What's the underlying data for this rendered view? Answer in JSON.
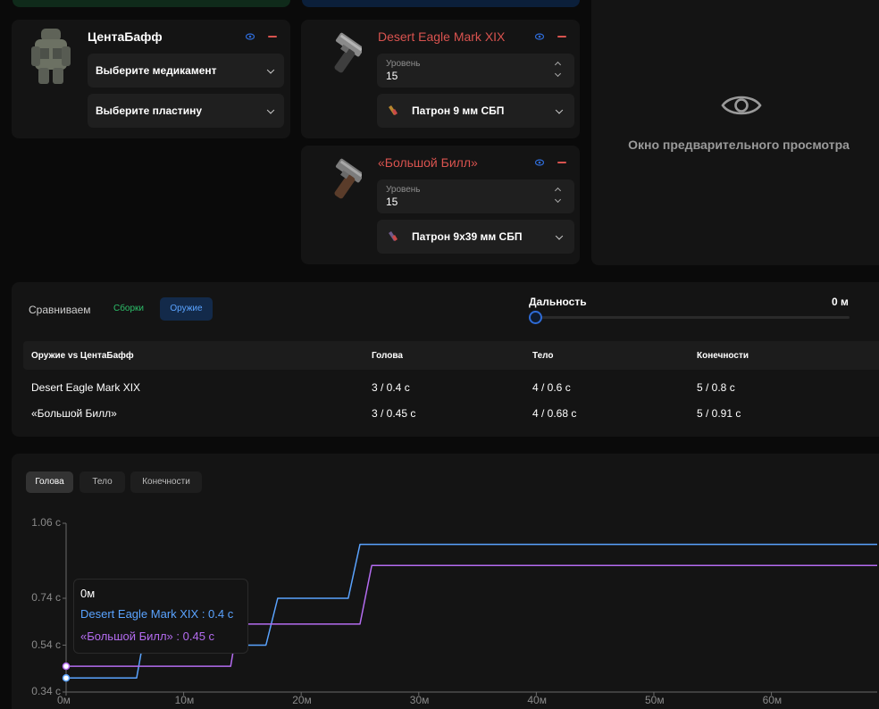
{
  "colors": {
    "background": "#0a0a0a",
    "panel": "#141414",
    "accent_red": "#d9534f",
    "accent_blue": "#2e6bd6",
    "series_blue": "#5aa3ff",
    "series_purple": "#b46cf0",
    "green": "#2dbf6a"
  },
  "armor_card": {
    "title": "ЦентаБафф",
    "medkit_select": "Выберите медикамент",
    "plate_select": "Выберите пластину",
    "icons": [
      "eye-icon",
      "minus-icon"
    ]
  },
  "weapons": [
    {
      "title": "Desert Eagle Mark XIX",
      "level_caption": "Уровень",
      "level_value": "15",
      "ammo": "Патрон 9 мм СБП"
    },
    {
      "title": "«Большой Билл»",
      "level_caption": "Уровень",
      "level_value": "15",
      "ammo": "Патрон 9x39 мм СБП"
    }
  ],
  "preview": {
    "text": "Окно предварительного просмотра",
    "icon": "eye-icon"
  },
  "compare": {
    "label": "Сравниваем",
    "mode_builds": "Сборки",
    "mode_weapons": "Оружие",
    "active_mode": "Оружие",
    "range_label": "Дальность",
    "range_value": "0 м",
    "range_fraction": 0
  },
  "table": {
    "headers": [
      "Оружие vs ЦентаБафф",
      "Голова",
      "Тело",
      "Конечности"
    ],
    "rows": [
      [
        "Desert Eagle Mark XIX",
        "3 / 0.4 с",
        "4 / 0.6 с",
        "5 / 0.8 с"
      ],
      [
        "«Большой Билл»",
        "3 / 0.45 с",
        "4 / 0.68 с",
        "5 / 0.91 с"
      ]
    ]
  },
  "chart_tabs": [
    "Голова",
    "Тело",
    "Конечности"
  ],
  "active_chart_tab": "Голова",
  "chart_data": {
    "type": "line",
    "title": "",
    "xlabel": "",
    "ylabel": "",
    "xlim": [
      0,
      69
    ],
    "ylim": [
      0.34,
      1.06
    ],
    "x_ticks": [
      "0м",
      "10м",
      "20м",
      "30м",
      "40м",
      "50м",
      "60м"
    ],
    "y_ticks": [
      "1.06 с",
      "0.74 с",
      "0.54 с",
      "0.34 с"
    ],
    "series": [
      {
        "name": "Desert Eagle Mark XIX",
        "color": "#5aa3ff",
        "points": [
          [
            0,
            0.4
          ],
          [
            6,
            0.4
          ],
          [
            6.5,
            0.54
          ],
          [
            17,
            0.54
          ],
          [
            18,
            0.74
          ],
          [
            24,
            0.74
          ],
          [
            25,
            0.97
          ],
          [
            69,
            0.97
          ]
        ]
      },
      {
        "name": "«Большой Билл»",
        "color": "#b46cf0",
        "points": [
          [
            0,
            0.45
          ],
          [
            14,
            0.45
          ],
          [
            14.3,
            0.54
          ],
          [
            14.6,
            0.63
          ],
          [
            25,
            0.63
          ],
          [
            26,
            0.88
          ],
          [
            69,
            0.88
          ]
        ]
      }
    ],
    "tooltip": {
      "x": "0м",
      "lines": [
        "Desert Eagle Mark XIX : 0.4 с",
        "«Большой Билл» : 0.45 с"
      ]
    }
  }
}
